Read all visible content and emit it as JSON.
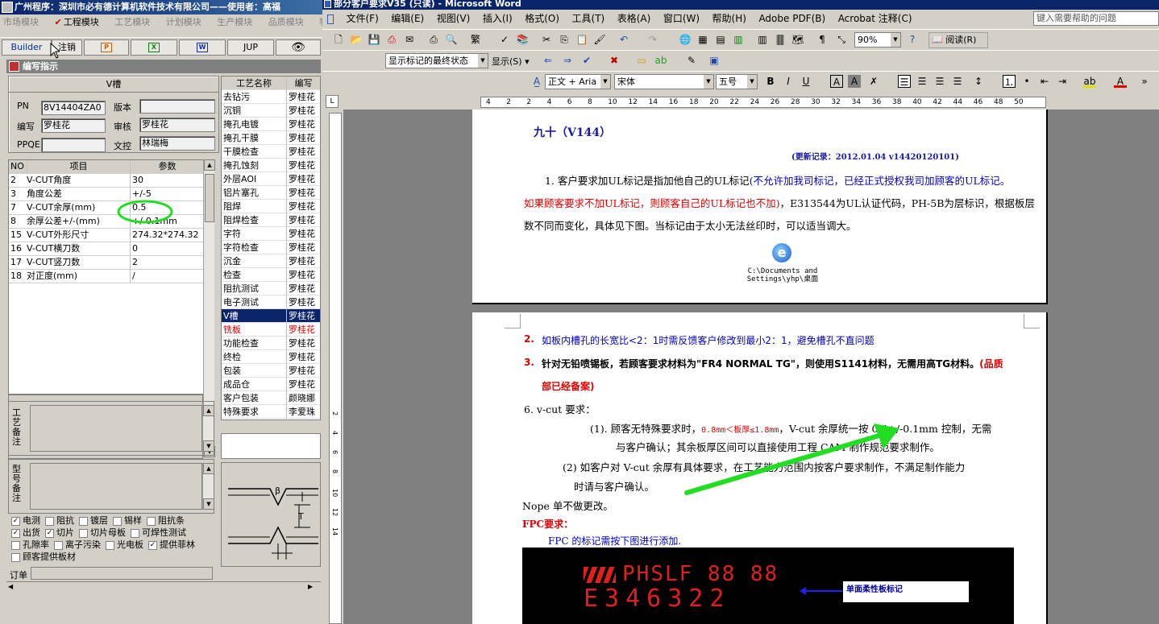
{
  "left_app": {
    "title": "广州程序：深圳市必有德计算机软件技术有限公司——使用者：高福",
    "menu": [
      "市场模块",
      "工程模块",
      "工艺模块",
      "计划模块",
      "生产模块",
      "品质模块",
      "物"
    ],
    "toolbar": {
      "builder": "Builder",
      "cancel": "注销",
      "jup": "JUP"
    },
    "panel_title": "编写指示",
    "section_title": "V槽",
    "pn_label": "PN",
    "pn_value": "8V14404ZA0",
    "version_label": "版本",
    "version_value": "",
    "writer_label": "编写",
    "writer_value": "罗桂花",
    "review_label": "审核",
    "review_value": "罗桂花",
    "ppqe_label": "PPQE",
    "ppqe_value": "",
    "proof_label": "文控",
    "proof_value": "林瑞梅",
    "param_headers": {
      "no": "NO",
      "item": "项目",
      "param": "参数"
    },
    "params": [
      {
        "no": "2",
        "item": "V-CUT角度",
        "value": "30"
      },
      {
        "no": "3",
        "item": "角度公差",
        "value": "+/-5"
      },
      {
        "no": "7",
        "item": "V-CUT余厚(mm)",
        "value": "0.5"
      },
      {
        "no": "8",
        "item": "余厚公差+/-(mm)",
        "value": "+/-0.1mm"
      },
      {
        "no": "15",
        "item": "V-CUT外形尺寸",
        "value": "274.32*274.32"
      },
      {
        "no": "16",
        "item": "V-CUT横刀数",
        "value": "0"
      },
      {
        "no": "17",
        "item": "V-CUT竖刀数",
        "value": "2"
      },
      {
        "no": "18",
        "item": "对正度(mm)",
        "value": "/"
      }
    ],
    "process_headers": {
      "name": "工艺名称",
      "writer": "编写"
    },
    "processes": [
      {
        "name": "去钻污",
        "writer": "罗桂花"
      },
      {
        "name": "沉铜",
        "writer": "罗桂花"
      },
      {
        "name": "掩孔电镀",
        "writer": "罗桂花"
      },
      {
        "name": "掩孔干膜",
        "writer": "罗桂花"
      },
      {
        "name": "干膜检查",
        "writer": "罗桂花"
      },
      {
        "name": "掩孔蚀刻",
        "writer": "罗桂花"
      },
      {
        "name": "外层AOI",
        "writer": "罗桂花"
      },
      {
        "name": "铝片塞孔",
        "writer": "罗桂花"
      },
      {
        "name": "阻焊",
        "writer": "罗桂花"
      },
      {
        "name": "阻焊检查",
        "writer": "罗桂花"
      },
      {
        "name": "字符",
        "writer": "罗桂花"
      },
      {
        "name": "字符检查",
        "writer": "罗桂花"
      },
      {
        "name": "沉金",
        "writer": "罗桂花"
      },
      {
        "name": "检查",
        "writer": "罗桂花"
      },
      {
        "name": "阻抗测试",
        "writer": "罗桂花"
      },
      {
        "name": "电子测试",
        "writer": "罗桂花"
      },
      {
        "name": "V槽",
        "writer": "罗桂花"
      },
      {
        "name": "铣板",
        "writer": "罗桂花"
      },
      {
        "name": "功能检查",
        "writer": "罗桂花"
      },
      {
        "name": "终检",
        "writer": "罗桂花"
      },
      {
        "name": "包装",
        "writer": "罗桂花"
      },
      {
        "name": "成品仓",
        "writer": "罗桂花"
      },
      {
        "name": "客户包装",
        "writer": "颜晓娜"
      },
      {
        "name": "特殊要求",
        "writer": "李爱珠"
      }
    ],
    "remark1_label": "工艺备注",
    "remark2_label": "型号备注",
    "checkbox_rows": [
      [
        {
          "label": "电测",
          "checked": true
        },
        {
          "label": "阻抗",
          "checked": false
        },
        {
          "label": "镀层",
          "checked": false
        },
        {
          "label": "锡样",
          "checked": false
        },
        {
          "label": "阻抗条",
          "checked": false
        }
      ],
      [
        {
          "label": "出货",
          "checked": true
        },
        {
          "label": "切片",
          "checked": true
        },
        {
          "label": "切片母板",
          "checked": false
        },
        {
          "label": "可焊性测试",
          "checked": false
        }
      ],
      [
        {
          "label": "孔隙率",
          "checked": false
        },
        {
          "label": "离子污染",
          "checked": false
        },
        {
          "label": "光电板",
          "checked": false
        },
        {
          "label": "提供菲林",
          "checked": true
        }
      ],
      [
        {
          "label": "顾客提供板材",
          "checked": false
        }
      ]
    ],
    "order_label": "订单",
    "diagram_labels": {
      "beta": "β",
      "t": "T"
    }
  },
  "word": {
    "title": "部分客户要求V35 (只读) - Microsoft Word",
    "menu": [
      "文件(F)",
      "编辑(E)",
      "视图(V)",
      "插入(I)",
      "格式(O)",
      "工具(T)",
      "表格(A)",
      "窗口(W)",
      "帮助(H)",
      "Adobe PDF(B)",
      "Acrobat 注释(C)"
    ],
    "help_placeholder": "键入需要帮助的问题",
    "zoom": "90%",
    "read_label": "阅读(R)",
    "markup_state": "显示标记的最终状态",
    "show_label": "显示(S)",
    "style": "正文 + Aria",
    "font": "宋体",
    "size": "五号",
    "ruler_marks": [
      "4",
      "2",
      "2",
      "4",
      "6",
      "8",
      "10",
      "12",
      "14",
      "16",
      "18",
      "20",
      "22",
      "24",
      "26",
      "28",
      "30",
      "32",
      "34",
      "36",
      "38",
      "40",
      "42",
      "44",
      "46",
      "48",
      "50"
    ],
    "vruler_marks": [
      "2",
      "4",
      "6",
      "8",
      "10",
      "12",
      "14"
    ],
    "doc": {
      "heading": "九十（V144）",
      "update": "(更新记录：2012.01.04    v14420120101)",
      "p1_a": "1. 客户要求加UL标记是指加他自己的UL标记",
      "p1_b": "(不允许加我司标记，已经正式授权我司加顾客的UL标记。",
      "p1_c": "如果顾客要求不加UL标记，则顾客自己的UL标记也不加)",
      "p1_d": "，E313544为UL认证代码，PH-5B为层标识，根据板层",
      "p1_e": "数不同而变化，具体见下图。当标记由于太小无法丝印时，可以适当调大。",
      "file_link": "C:\\Documents and Settings\\yhp\\桌面",
      "item2_no": "2.",
      "item2": "如板内槽孔的长宽比<2：1时需反馈客户修改到最小2：1，避免槽孔不直问题",
      "item3_no": "3.",
      "item3_a": "针对无铅喷锡板，若顾客要求材料为\"FR4 NORMAL TG\"，则使用S1141材料，无需用高TG材料。",
      "item3_b": "(品质",
      "item3_c": "部已经备案)",
      "item6": "6.   v-cut 要求：",
      "sub1_a": "(1). 顾客无特殊要求时，",
      "sub1_b": "0.8mm＜板厚≤1.8mm",
      "sub1_c": "，V-cut 余厚统一按 0.4+/-0.1mm 控制，无需",
      "sub1_d": "与客户确认；其余板厚区间可以直接使用工程 CAM 制作规范要求制作。",
      "sub2_a": "(2) 如客户对 V-cut 余厚有具体要求，在工艺能力范围内按客户要求制作，不满足制作能力",
      "sub2_b": "时请与客户确认。",
      "nope": "Nope 单不做更改。",
      "fpc_title": "FPC要求：",
      "fpc_text": "FPC 的标记需按下图进行添加.",
      "img_line1": "PHSLF 88 88",
      "img_line2": "E346322",
      "img_note": "单面柔性板标记"
    }
  },
  "colors": {
    "red": "#e00000",
    "blue": "#0000c0",
    "selection": "#0a246a",
    "annotation_green": "#22dd22"
  }
}
